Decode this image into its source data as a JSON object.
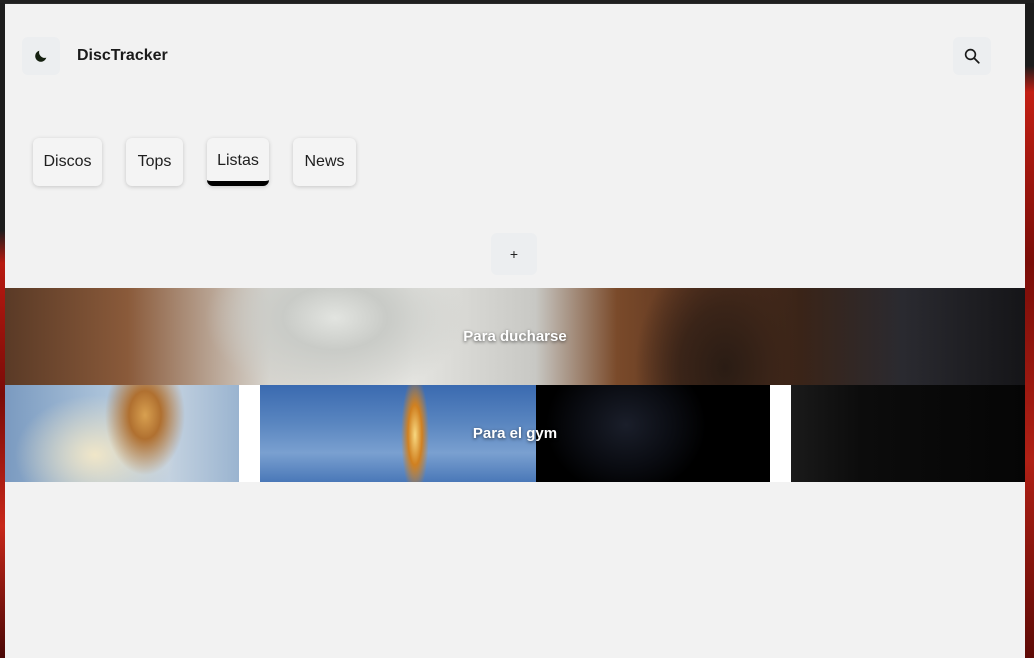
{
  "header": {
    "app_title": "DiscTracker",
    "theme_icon": "moon-icon",
    "search_icon": "search-icon"
  },
  "tabs": [
    {
      "label": "Discos",
      "active": false
    },
    {
      "label": "Tops",
      "active": false
    },
    {
      "label": "Listas",
      "active": true
    },
    {
      "label": "News",
      "active": false
    }
  ],
  "add_button": {
    "label": "+"
  },
  "lists": [
    {
      "title": "Para ducharse"
    },
    {
      "title": "Para el gym"
    }
  ],
  "colors": {
    "background": "#f2f2f2",
    "tab_active_indicator": "#000000",
    "banner_text": "#ffffff"
  }
}
